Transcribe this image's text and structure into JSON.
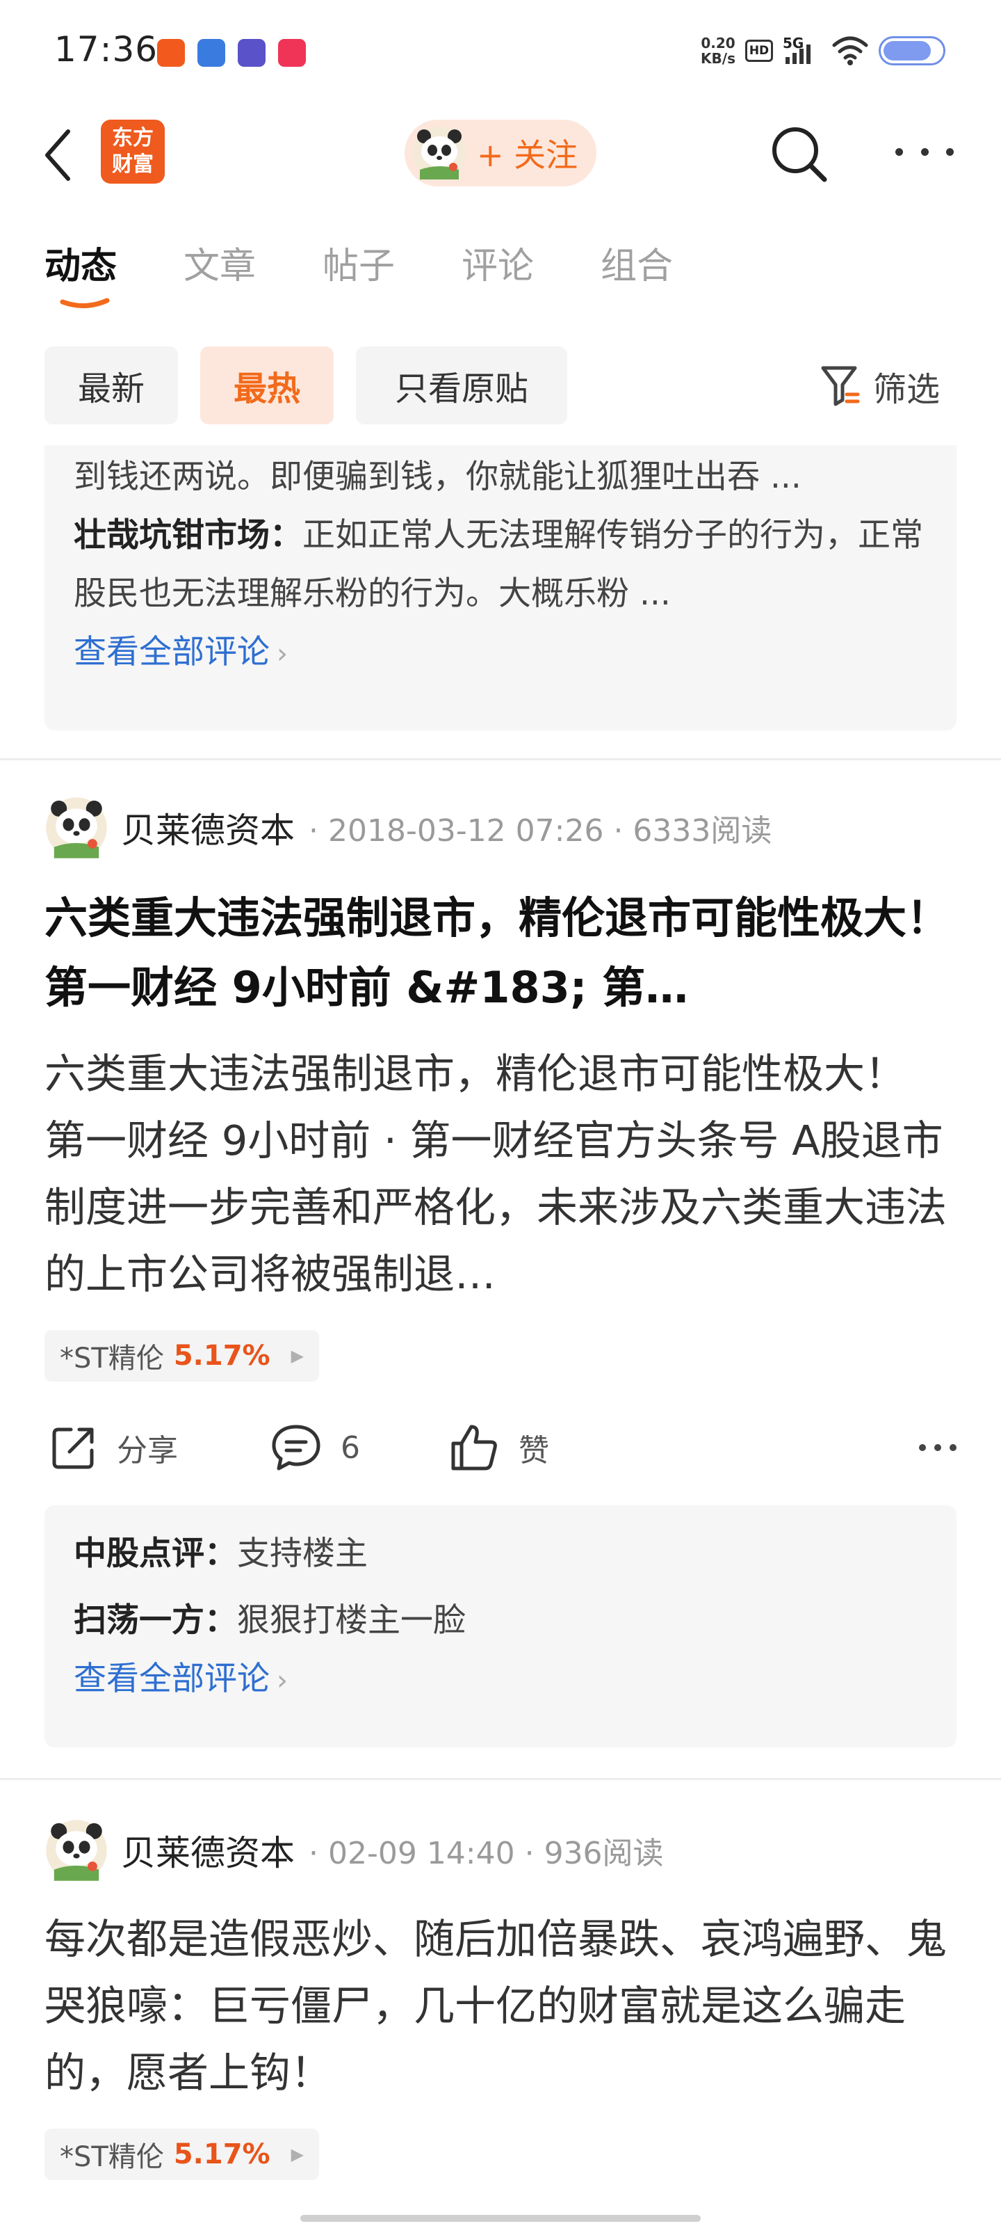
{
  "status_bar": {
    "time": "17:36",
    "speed_value": "0.20",
    "speed_unit": "KB/s",
    "hd": "HD",
    "network": "5G",
    "app_icon_colors": [
      "#f25a1d",
      "#3a7be0",
      "#5a52c8",
      "#ef3458"
    ]
  },
  "nav": {
    "logo_line1": "东方",
    "logo_line2": "财富",
    "follow_label": "+ 关注"
  },
  "tabs": [
    "动态",
    "文章",
    "帖子",
    "评论",
    "组合"
  ],
  "filters": {
    "chips": [
      "最新",
      "最热",
      "只看原贴"
    ],
    "active_chip": "最热",
    "filter_label": "筛选"
  },
  "top_comments": {
    "line1": "到钱还两说。即便骗到钱，你就能让狐狸吐出吞 ...",
    "comment2_author": "壮哉坑钳市场：",
    "comment2_text": "正如正常人无法理解传销分子的行为，正常股民也无法理解乐粉的行为。大概乐粉 ...",
    "view_all": "查看全部评论"
  },
  "post1": {
    "author": "贝莱德资本",
    "meta": "· 2018-03-12 07:26 · 6333阅读",
    "title": "六类重大违法强制退市，精伦退市可能性极大！ 第一财经 9小时前 &#183; 第…",
    "body": "六类重大违法强制退市，精伦退市可能性极大！ 第一财经 9小时前 · 第一财经官方头条号 A股退市制度进一步完善和严格化，未来涉及六类重大违法的上市公司将被强制退…",
    "stock_name": "*ST精伦",
    "stock_pct": "5.17%",
    "share_label": "分享",
    "comment_count": "6",
    "like_label": "赞",
    "comments": [
      {
        "author": "中股点评：",
        "text": "支持楼主"
      },
      {
        "author": "扫荡一方：",
        "text": "狠狠打楼主一脸"
      }
    ],
    "view_all": "查看全部评论"
  },
  "post2": {
    "author": "贝莱德资本",
    "meta": "· 02-09 14:40 · 936阅读",
    "body": "每次都是造假恶炒、随后加倍暴跌、哀鸿遍野、鬼哭狼嚎：巨亏僵尸，几十亿的财富就是这么骗走的，愿者上钩！",
    "stock_name": "*ST精伦",
    "stock_pct": "5.17%"
  },
  "colors": {
    "accent": "#f26a1b",
    "link": "#2e6fd1",
    "rise": "#e8541a"
  }
}
